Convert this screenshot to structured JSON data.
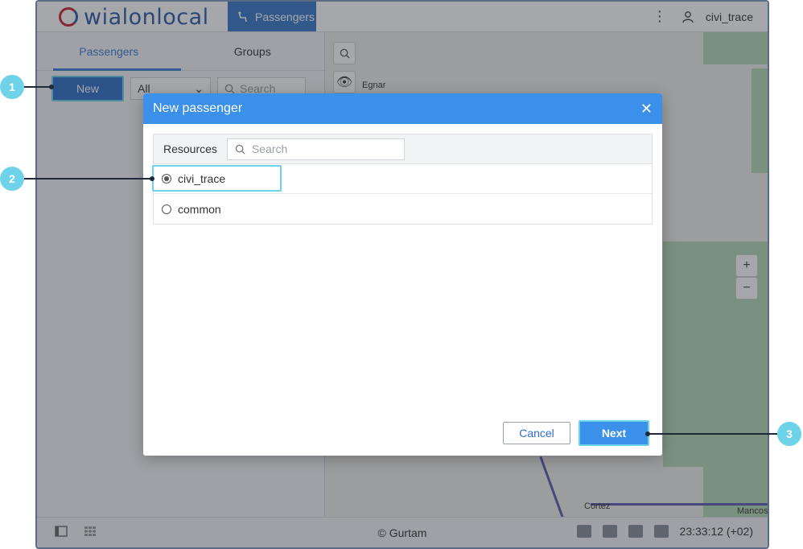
{
  "app": {
    "logo_text": "wialon",
    "logo_text_2": "local",
    "active_module": "Passengers",
    "user_name": "civi_trace"
  },
  "left_panel": {
    "tabs": [
      {
        "label": "Passengers",
        "active": true
      },
      {
        "label": "Groups",
        "active": false
      }
    ],
    "new_button": "New",
    "filter_value": "All",
    "search_placeholder": "Search"
  },
  "map": {
    "labels": [
      "Egnar",
      "Cortez",
      "Mancos"
    ]
  },
  "bottom_bar": {
    "copyright": "© Gurtam",
    "time": "23:33:12 (+02)"
  },
  "dialog": {
    "title": "New passenger",
    "resources_label": "Resources",
    "search_placeholder": "Search",
    "resources": [
      {
        "name": "civi_trace",
        "selected": true
      },
      {
        "name": "common",
        "selected": false
      }
    ],
    "cancel_label": "Cancel",
    "next_label": "Next"
  },
  "callouts": [
    "1",
    "2",
    "3"
  ],
  "colors": {
    "accent": "#3b91ea",
    "callout": "#6ed3e8",
    "header_blue": "#3a78c9"
  }
}
